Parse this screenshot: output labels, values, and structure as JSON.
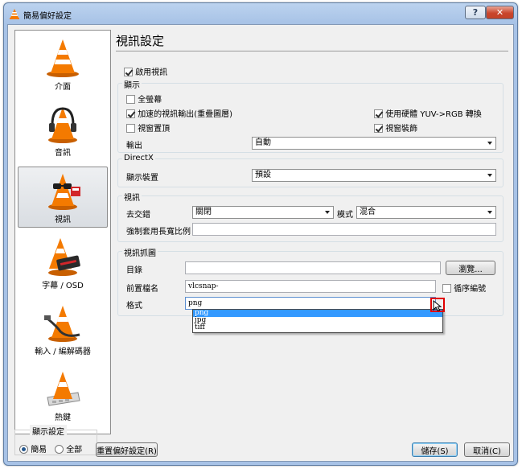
{
  "window": {
    "title": "簡易偏好設定",
    "help_label": "?",
    "close_label": "✕"
  },
  "sidebar": {
    "items": [
      {
        "label": "介面",
        "icon": "cone-icon",
        "selected": false
      },
      {
        "label": "音訊",
        "icon": "cone-headphones-icon",
        "selected": false
      },
      {
        "label": "視訊",
        "icon": "cone-glasses-icon",
        "selected": true
      },
      {
        "label": "字幕 / OSD",
        "icon": "cone-subtitle-icon",
        "selected": false
      },
      {
        "label": "輸入 / 編解碼器",
        "icon": "cone-cable-icon",
        "selected": false
      },
      {
        "label": "熱鍵",
        "icon": "cone-keyboard-icon",
        "selected": false
      }
    ]
  },
  "display_settings": {
    "caption": "顯示設定",
    "simple_label": "簡易",
    "all_label": "全部",
    "selected": "簡易"
  },
  "buttons": {
    "reset": "重置偏好設定(R)",
    "save": "儲存(S)",
    "cancel": "取消(C)"
  },
  "main": {
    "title": "視訊設定",
    "enable_video": {
      "label": "啟用視訊",
      "checked": true
    },
    "display_group": {
      "caption": "顯示",
      "fullscreen": {
        "label": "全螢幕",
        "checked": false
      },
      "accelerated": {
        "label": "加速的視訊輸出(重疊圖層)",
        "checked": true
      },
      "always_on_top": {
        "label": "視窗置頂",
        "checked": false
      },
      "hw_yuv": {
        "label": "使用硬體 YUV->RGB 轉換",
        "checked": true
      },
      "decorations": {
        "label": "視窗裝飾",
        "checked": true
      },
      "output_label": "輸出",
      "output_value": "自動"
    },
    "directx_group": {
      "caption": "DirectX",
      "device_label": "顯示裝置",
      "device_value": "預設"
    },
    "video_group": {
      "caption": "視訊",
      "deinterlace_label": "去交錯",
      "deinterlace_value": "關閉",
      "mode_label": "模式",
      "mode_value": "混合",
      "aspect_label": "強制套用長寬比例",
      "aspect_value": ""
    },
    "snapshot_group": {
      "caption": "視訊抓圖",
      "dir_label": "目錄",
      "dir_value": "",
      "browse_label": "瀏覽...",
      "prefix_label": "前置檔名",
      "prefix_value": "vlcsnap-",
      "seq_label": "循序編號",
      "seq_checked": false,
      "format_label": "格式",
      "format_value": "png",
      "format_options": [
        "png",
        "jpg",
        "tiff"
      ],
      "format_highlighted": "png"
    }
  },
  "colors": {
    "accent": "#3399ff",
    "cone_orange": "#f47a00",
    "highlight_box": "#e00000"
  }
}
